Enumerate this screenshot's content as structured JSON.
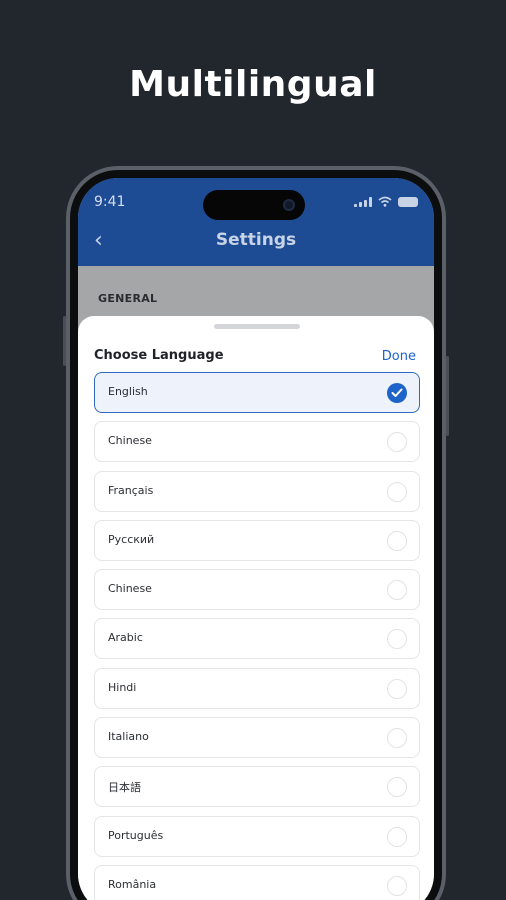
{
  "headline": "Multilingual",
  "status": {
    "time": "9:41"
  },
  "nav": {
    "back_icon": "‹",
    "title": "Settings"
  },
  "section": {
    "label": "GENERAL"
  },
  "sheet": {
    "title": "Choose Language",
    "done_label": "Done"
  },
  "colors": {
    "background": "#22262d",
    "header": "#1d4c94",
    "accent": "#1e63c7"
  },
  "languages": [
    {
      "label": "English",
      "selected": true
    },
    {
      "label": "Chinese",
      "selected": false
    },
    {
      "label": "Français",
      "selected": false
    },
    {
      "label": "Русский",
      "selected": false
    },
    {
      "label": "Chinese",
      "selected": false
    },
    {
      "label": "Arabic",
      "selected": false
    },
    {
      "label": "Hindi",
      "selected": false
    },
    {
      "label": "Italiano",
      "selected": false
    },
    {
      "label": "日本語",
      "selected": false
    },
    {
      "label": "Português",
      "selected": false
    },
    {
      "label": "România",
      "selected": false
    }
  ]
}
